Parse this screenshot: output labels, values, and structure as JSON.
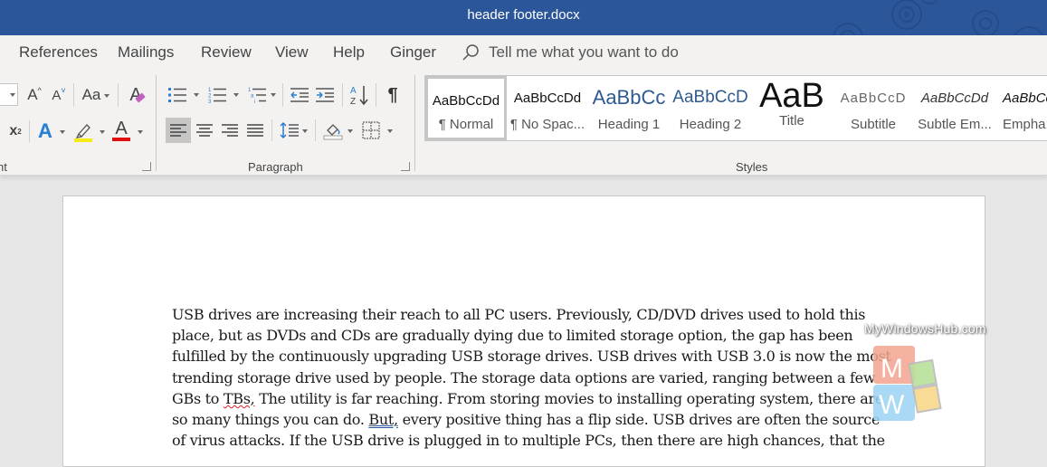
{
  "window": {
    "title": "header footer.docx"
  },
  "tabs": [
    {
      "label": "References"
    },
    {
      "label": "Mailings"
    },
    {
      "label": "Review"
    },
    {
      "label": "View"
    },
    {
      "label": "Help"
    },
    {
      "label": "Ginger"
    }
  ],
  "tell_me": {
    "placeholder": "Tell me what you want to do",
    "icon": "lightbulb-search-icon"
  },
  "ribbon": {
    "font_group": {
      "label_partial": "nt",
      "grow_font": "A",
      "shrink_font": "A",
      "change_case": "Aa",
      "clear_formatting": "A",
      "superscript": "x",
      "superscript_exp": "2",
      "text_effects": "A",
      "font_color": "A",
      "highlight_color": "#f5ea14",
      "font_color_value": "#e01010"
    },
    "paragraph_group": {
      "label": "Paragraph",
      "show_marks": "¶"
    },
    "styles_group": {
      "label": "Styles",
      "items": [
        {
          "sample": "AaBbCcDd",
          "name": "¶ Normal",
          "selected": true
        },
        {
          "sample": "AaBbCcDd",
          "name": "¶ No Spac..."
        },
        {
          "sample": "AaBbCc",
          "name": "Heading 1"
        },
        {
          "sample": "AaBbCcD",
          "name": "Heading 2"
        },
        {
          "sample": "AaB",
          "name": "Title"
        },
        {
          "sample": "AaBbCcD",
          "name": "Subtitle"
        },
        {
          "sample": "AaBbCcDd",
          "name": "Subtle Em..."
        },
        {
          "sample": "AaBbCcDd",
          "name": "Empha..."
        }
      ]
    }
  },
  "document": {
    "lines": [
      {
        "text": "USB drives are increasing their reach to all PC users. Previously, CD/DVD drives used to hold this"
      },
      {
        "text": "place, but as DVDs and CDs are gradually dying due to limited storage option, the gap has been"
      },
      {
        "text": "fulfilled by the continuously upgrading USB storage drives. USB drives with USB 3.0 is now the most"
      },
      {
        "text": "trending storage drive used by people. The storage data options are varied, ranging between a few"
      },
      {
        "pre": "GBs to ",
        "flag": "TBs,",
        "post": " The utility is far reaching. From storing movies to installing operating system, there are"
      },
      {
        "pre": "so many things you can do. ",
        "flag": "But,",
        "post": " every positive thing has a flip side. USB drives are often the source"
      },
      {
        "text": "of virus attacks. If the USB drive is plugged in to multiple PCs, then there are high chances, that the"
      }
    ]
  },
  "watermark": {
    "text": "MyWindowsHub.com",
    "letter_top": "M",
    "letter_bottom": "W"
  }
}
